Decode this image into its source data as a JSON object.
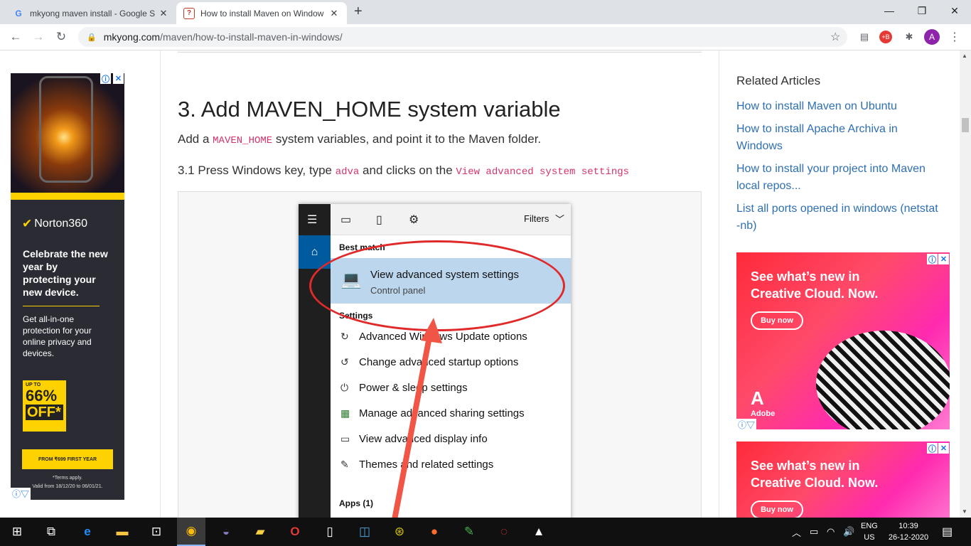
{
  "browser": {
    "tabs": [
      {
        "title": "mkyong maven install - Google S",
        "favicon": "G"
      },
      {
        "title": "How to install Maven on Window",
        "favicon": "?"
      }
    ],
    "new_tab_icon": "+",
    "url_host": "mkyong.com",
    "url_path": "/maven/how-to-install-maven-in-windows/",
    "profile_initial": "A",
    "window_controls": {
      "minimize": "—",
      "maximize": "❐",
      "close": "✕"
    }
  },
  "left_ad": {
    "brand": "Norton360",
    "headline": "Celebrate the new year by protecting your new device.",
    "body": "Get all-in-one protection for your online privacy and devices.",
    "upto": "UP TO",
    "discount": "66%",
    "off": "OFF*",
    "cta": "FROM ₹699 FIRST YEAR",
    "terms": "*Terms apply.",
    "valid": "Valid from 18/12/20 to 06/01/21."
  },
  "article": {
    "heading": "3. Add MAVEN_HOME system variable",
    "p1_before": "Add a ",
    "p1_code": "MAVEN_HOME",
    "p1_after": " system variables, and point it to the Maven folder.",
    "p2_before": "3.1 Press Windows key, type ",
    "p2_code1": "adva",
    "p2_mid": " and clicks on the ",
    "p2_code2": "View advanced system settings"
  },
  "start_panel": {
    "filters": "Filters",
    "best_match_header": "Best match",
    "best_match_title": "View advanced system settings",
    "best_match_sub": "Control panel",
    "settings_header": "Settings",
    "settings_items": [
      "Advanced Windows Update options",
      "Change advanced startup options",
      "Power & sleep settings",
      "Manage advanced sharing settings",
      "View advanced display info",
      "Themes and related settings"
    ],
    "apps_header": "Apps (1)"
  },
  "sidebar": {
    "related_title": "Related Articles",
    "links": [
      "How to install Maven on Ubuntu",
      "How to install Apache Archiva in Windows",
      "How to install your project into Maven local repos...",
      "List all ports opened in windows (netstat -nb)"
    ],
    "ad_text": "See what’s new in Creative Cloud. Now.",
    "ad_button": "Buy now",
    "ad_brand": "Adobe"
  },
  "taskbar": {
    "lang": "ENG",
    "region": "US",
    "time": "10:39",
    "date": "26-12-2020"
  }
}
